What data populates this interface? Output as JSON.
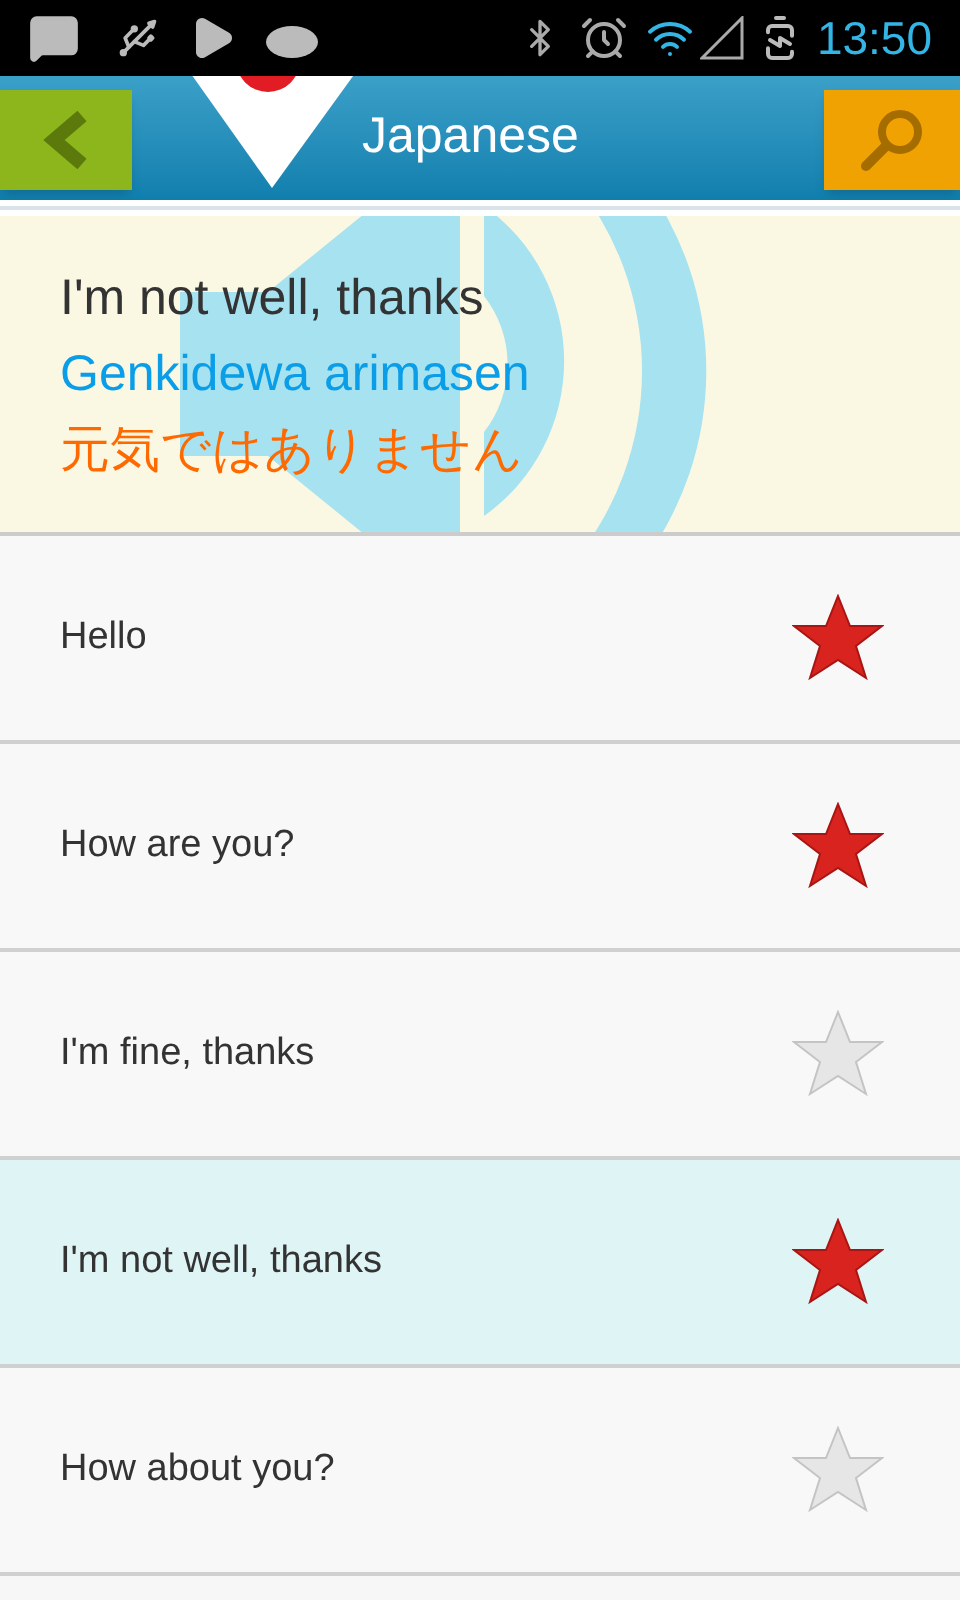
{
  "status_bar": {
    "time": "13:50"
  },
  "header": {
    "title": "Japanese"
  },
  "card": {
    "english": "I'm not well, thanks",
    "romaji": "Genkidewa arimasen",
    "japanese": "元気ではありません"
  },
  "rows": [
    {
      "text": "Hello",
      "starred": true,
      "selected": false
    },
    {
      "text": "How are you?",
      "starred": true,
      "selected": false
    },
    {
      "text": "I'm fine, thanks",
      "starred": false,
      "selected": false
    },
    {
      "text": "I'm not well, thanks",
      "starred": true,
      "selected": true
    },
    {
      "text": "How about you?",
      "starred": false,
      "selected": false
    }
  ]
}
